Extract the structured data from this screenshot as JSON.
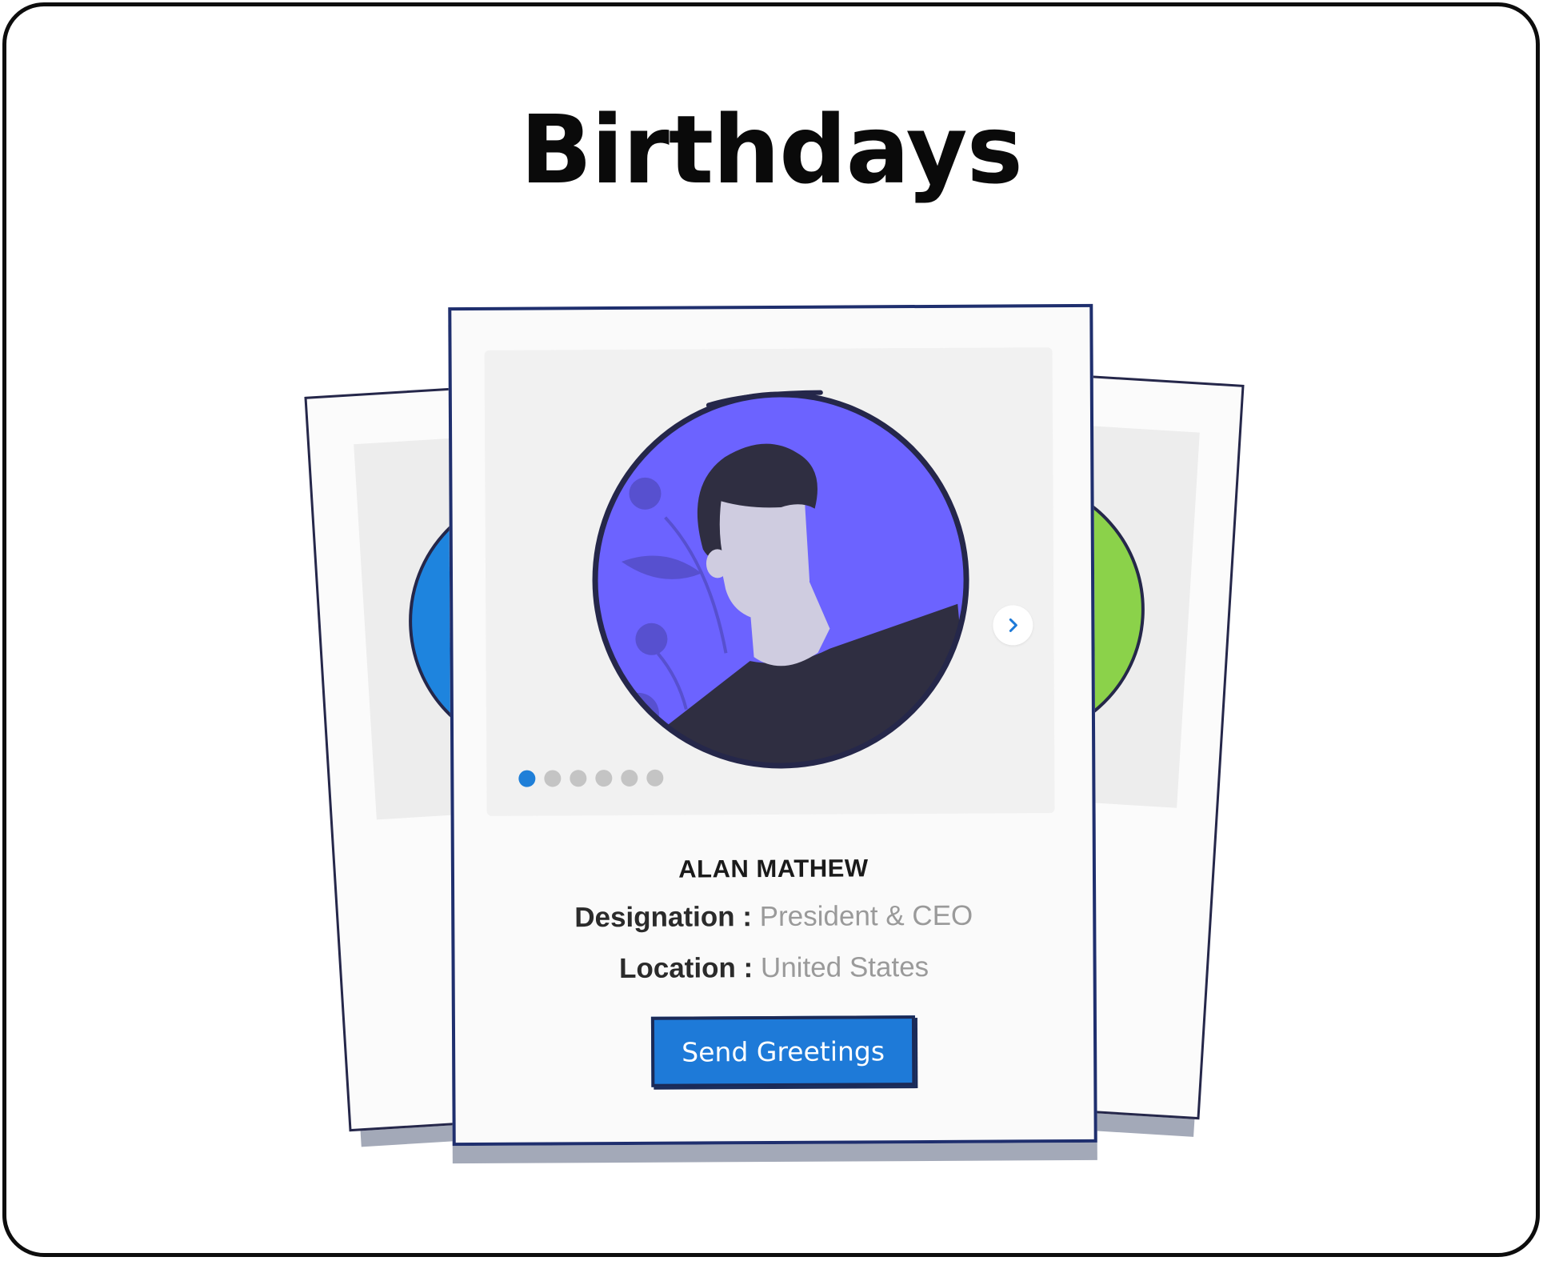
{
  "page": {
    "title": "Birthdays"
  },
  "card": {
    "name": "ALAN MATHEW",
    "designation_label": "Designation :",
    "designation_value": "President & CEO",
    "location_label": "Location :",
    "location_value": "United States",
    "send_label": "Send Greetings",
    "carousel": {
      "total_slides": 6,
      "active_slide": 1
    }
  },
  "colors": {
    "accent": "#1e7ad8",
    "avatar_bg": "#6c63ff",
    "left_card_avatar": "#1e84de",
    "right_card_avatar": "#8bd24a",
    "outline": "#25274a"
  },
  "icons": {
    "next": "chevron-right-icon",
    "avatar": "person-avatar-icon"
  }
}
